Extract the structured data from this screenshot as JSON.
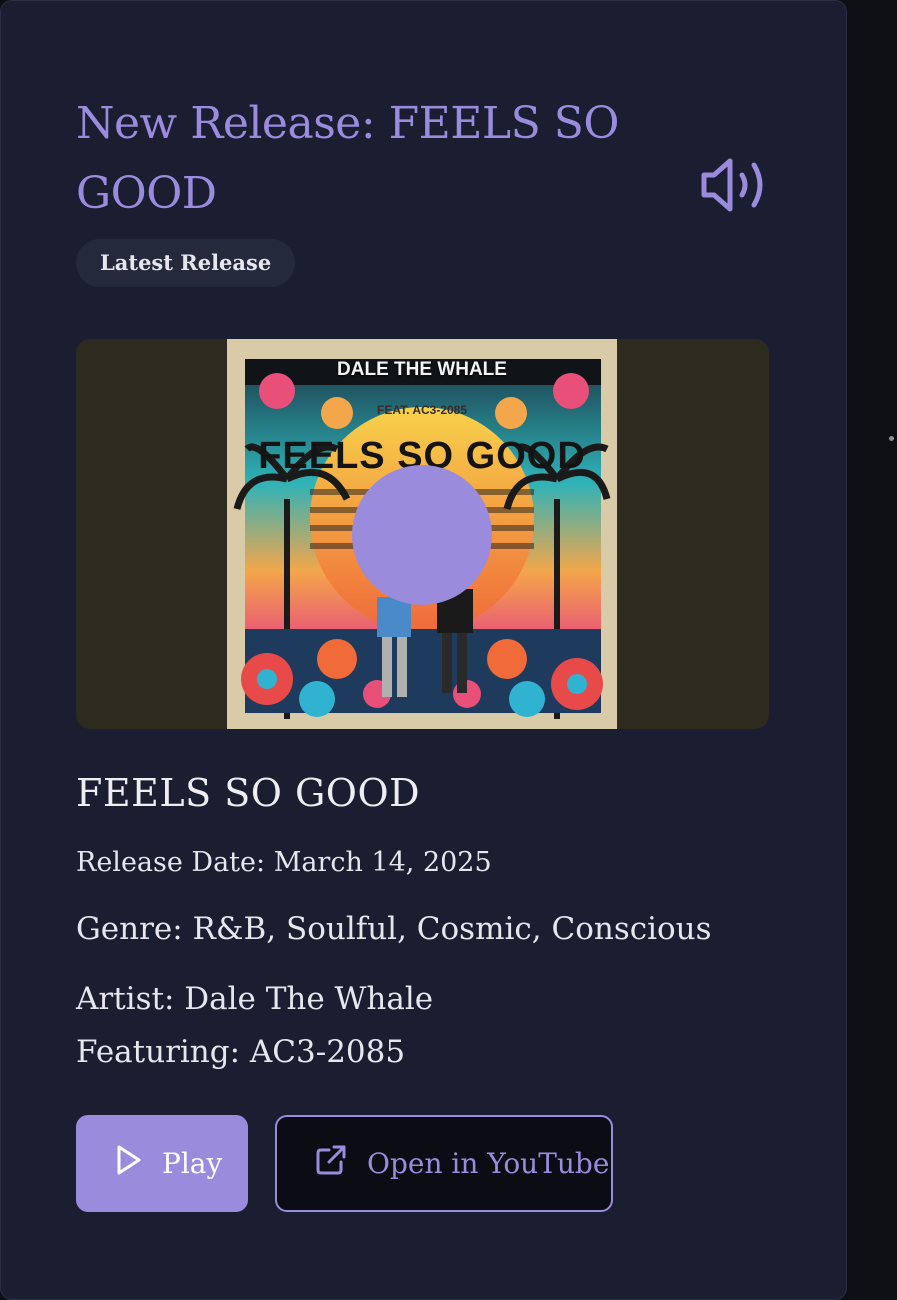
{
  "header": {
    "title": "New Release: FEELS SO GOOD",
    "badge": "Latest Release",
    "sound_icon": "volume-icon"
  },
  "cover_art": {
    "artist_text": "DALE THE WHALE",
    "feat_text": "FEAT. AC3-2085",
    "title_text": "FEELS SO GOOD",
    "play_overlay_icon": "play-overlay"
  },
  "release": {
    "title": "FEELS SO GOOD",
    "release_date": "Release Date: March 14, 2025",
    "genre": "Genre: R&B, Soulful, Cosmic, Conscious",
    "artist": "Artist: Dale The Whale",
    "featuring": "Featuring: AC3-2085"
  },
  "actions": {
    "play_label": "Play",
    "play_icon": "play-icon",
    "youtube_label": "Open in YouTube",
    "youtube_icon": "external-link-icon"
  },
  "colors": {
    "accent": "#9b8bdc",
    "card_bg": "#1a1e30",
    "page_bg": "#0d0f15",
    "media_bg": "#2d2a20"
  }
}
